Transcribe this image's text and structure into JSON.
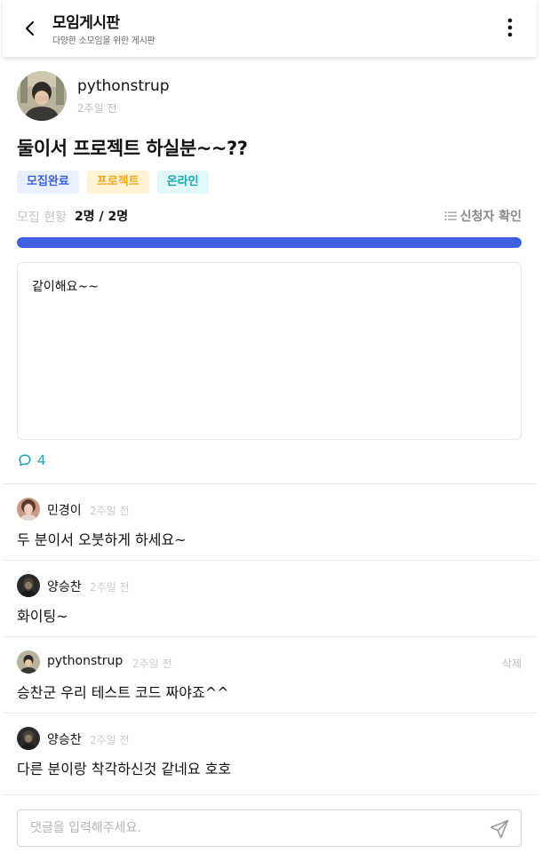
{
  "header": {
    "title": "모임게시판",
    "subtitle": "다양한 소모임을 위한 게시판"
  },
  "post": {
    "author": "pythonstrup",
    "time": "2주일 전",
    "title": "둘이서 프로젝트 하실분~~??",
    "tags": [
      {
        "label": "모집완료",
        "bg": "#e8efff",
        "color": "#3d5fe0"
      },
      {
        "label": "프로젝트",
        "bg": "#fff4d4",
        "color": "#f5a623"
      },
      {
        "label": "온라인",
        "bg": "#e2f7f7",
        "color": "#19a7b0"
      }
    ],
    "recruit_label": "모집 현황",
    "recruit_count": "2명 / 2명",
    "recruit_progress": 1.0,
    "applicants_label": "신청자 확인",
    "content": "같이해요~~",
    "comment_count": "4"
  },
  "comments": [
    {
      "author": "민경이",
      "time": "2주일 전",
      "text": "두 분이서 오붓하게 하세요~",
      "delete_label": ""
    },
    {
      "author": "양승찬",
      "time": "2주일 전",
      "text": "화이팅~",
      "delete_label": ""
    },
    {
      "author": "pythonstrup",
      "time": "2주일 전",
      "text": "승찬군 우리 테스트 코드 짜야죠^^",
      "delete_label": "삭제"
    },
    {
      "author": "양승찬",
      "time": "2주일 전",
      "text": "다른 분이랑 착각하신것 같네요 호호",
      "delete_label": ""
    }
  ],
  "comment_input": {
    "placeholder": "댓글을 입력해주세요.",
    "value": ""
  },
  "colors": {
    "accent": "#3d5fe0",
    "teal": "#1aa3b0"
  }
}
